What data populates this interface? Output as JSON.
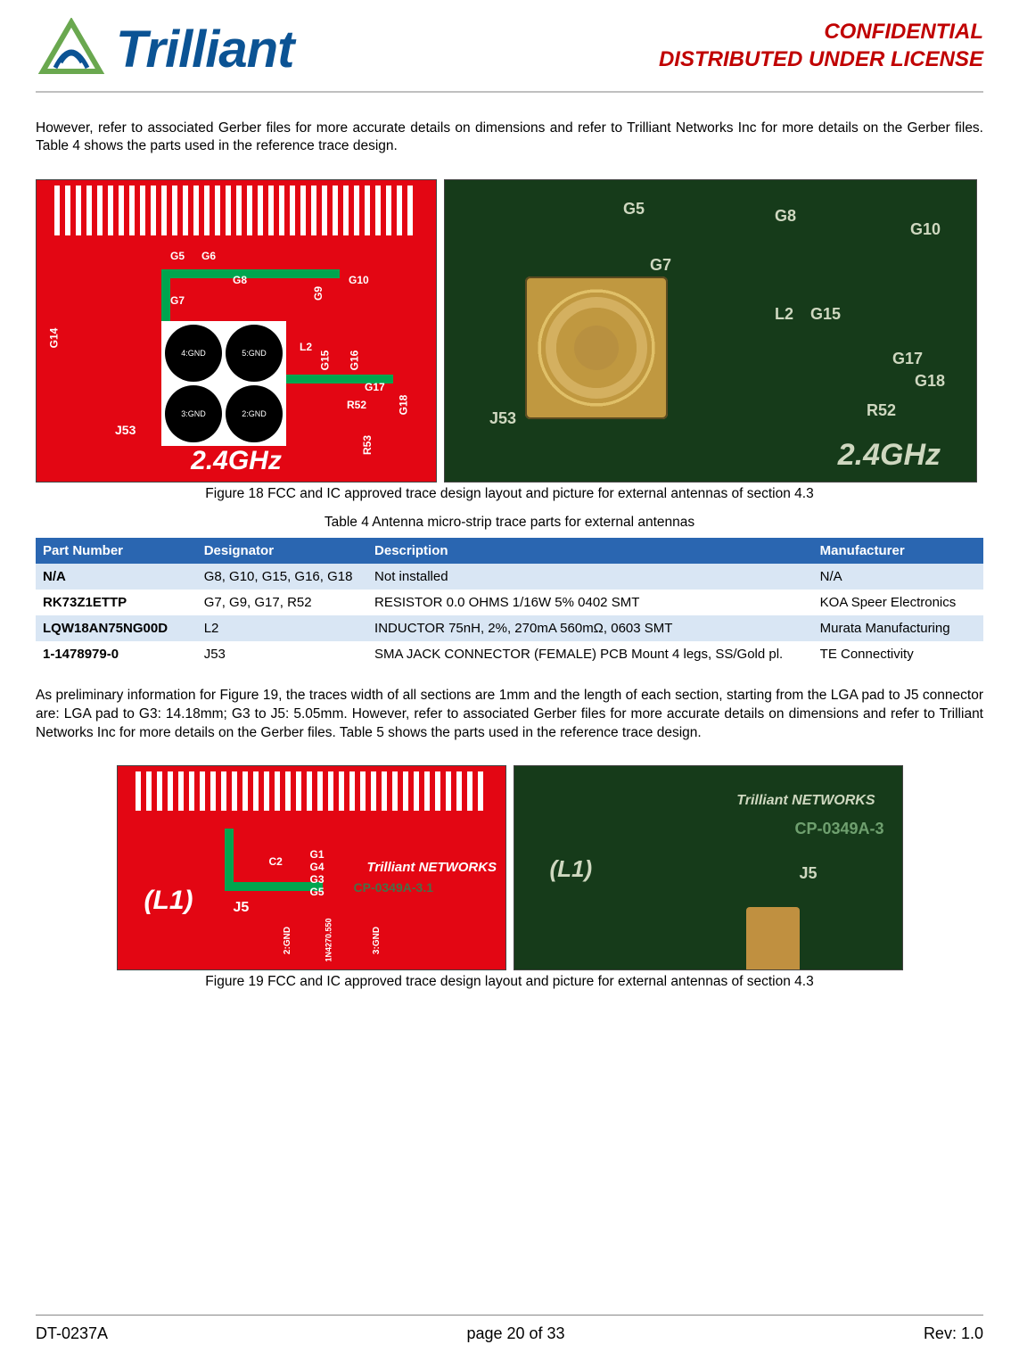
{
  "header": {
    "logo_text": "Trilliant",
    "confidential": "CONFIDENTIAL",
    "distributed": "DISTRIBUTED UNDER LICENSE"
  },
  "paragraph1": "However, refer to associated Gerber files for more accurate details on dimensions and refer to Trilliant Networks Inc for more details on the Gerber files.  Table 4 shows the parts used in the reference trace design.",
  "fig18": {
    "caption": "Figure 18  FCC and IC approved trace design layout and picture for external antennas of section 4.3",
    "band": "2.4GHz",
    "j53": "J53",
    "refs_left": [
      "G5",
      "G6",
      "G7",
      "G8",
      "G9",
      "G10",
      "G14",
      "G15",
      "G16",
      "G17",
      "G18",
      "L2",
      "R52",
      "R53"
    ],
    "refs_right": [
      "G5",
      "G7",
      "G8",
      "G10",
      "L2",
      "G15",
      "G17",
      "G18",
      "R52",
      "J53"
    ],
    "pads": [
      "4:GND",
      "5:GND",
      "3:GND",
      "2:GND"
    ]
  },
  "table4": {
    "caption": "Table 4  Antenna micro-strip trace parts for external antennas",
    "headers": [
      "Part Number",
      "Designator",
      "Description",
      "Manufacturer"
    ],
    "rows": [
      {
        "pn": "N/A",
        "desig": "G8, G10, G15, G16, G18",
        "desc": "Not installed",
        "mfg": "N/A"
      },
      {
        "pn": "RK73Z1ETTP",
        "desig": "G7, G9, G17, R52",
        "desc": "RESISTOR 0.0 OHMS 1/16W 5% 0402 SMT",
        "mfg": "KOA Speer Electronics"
      },
      {
        "pn": "LQW18AN75NG00D",
        "desig": "L2",
        "desc": "INDUCTOR 75nH, 2%, 270mA 560mΩ, 0603 SMT",
        "mfg": "Murata Manufacturing"
      },
      {
        "pn": "1-1478979-0",
        "desig": "J53",
        "desc": "SMA JACK CONNECTOR (FEMALE) PCB Mount 4 legs, SS/Gold pl.",
        "mfg": "TE Connectivity"
      }
    ]
  },
  "paragraph2": "As preliminary information for Figure 19, the traces width of all sections are 1mm and the length of each section, starting from the LGA pad to J5 connector are: LGA pad to G3: 14.18mm; G3 to J5: 5.05mm.  However, refer to associated Gerber files for more accurate details on dimensions and refer to Trilliant Networks Inc for more details on the Gerber files.  Table 5 shows the parts used in the reference trace design.",
  "fig19": {
    "caption": "Figure 19  FCC and IC approved trace design layout and picture for external antennas of section 4.3",
    "refs_left": [
      "G1",
      "G3",
      "G4",
      "G5",
      "C2",
      "(L1)",
      "J5",
      "2:GND",
      "3:GND",
      "1N4270.550"
    ],
    "silk_left": "CP-0349A-3.1",
    "logo_right": "Trilliant NETWORKS",
    "silk_right": "CP-0349A-3",
    "l1": "(L1)",
    "j5": "J5"
  },
  "footer": {
    "doc": "DT-0237A",
    "page": "page 20 of 33",
    "rev": "Rev: 1.0"
  }
}
